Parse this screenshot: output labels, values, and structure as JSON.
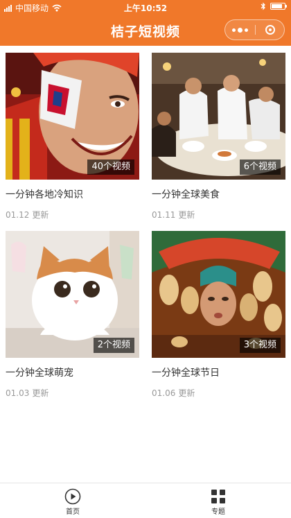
{
  "status_bar": {
    "carrier": "中国移动",
    "time": "上午10:52"
  },
  "nav": {
    "title": "桔子短视频"
  },
  "cards": [
    {
      "title": "一分钟各地冷知识",
      "date": "01.12",
      "update": "更新",
      "badge": "40个视频"
    },
    {
      "title": "一分钟全球美食",
      "date": "01.11",
      "update": "更新",
      "badge": "6个视频"
    },
    {
      "title": "一分钟全球萌宠",
      "date": "01.03",
      "update": "更新",
      "badge": "2个视频"
    },
    {
      "title": "一分钟全球节日",
      "date": "01.06",
      "update": "更新",
      "badge": "3个视频"
    }
  ],
  "tabbar": {
    "items": [
      {
        "label": "首页",
        "icon": "play-circle-icon"
      },
      {
        "label": "专题",
        "icon": "grid-icon"
      }
    ]
  },
  "colors": {
    "brand": "#f0782a",
    "meta_text": "#999999"
  }
}
